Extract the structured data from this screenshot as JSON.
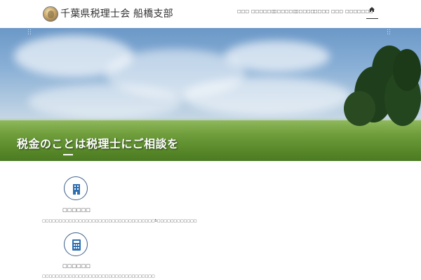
{
  "header": {
    "site_title": "千葉県税理士会 船橋支部",
    "nav": [
      {
        "label": "□□□"
      },
      {
        "label": "□□□□□□"
      },
      {
        "label": "□□□□□□"
      },
      {
        "label": "□□□□□"
      },
      {
        "label": "□□□□"
      },
      {
        "label": "□□□"
      },
      {
        "label": "□□□□□□□"
      }
    ],
    "home_icon": "home-icon"
  },
  "hero": {
    "tagline": "税金のことは税理士にご相談を"
  },
  "features": [
    {
      "icon": "building-icon",
      "title": "□□□□□□",
      "desc": "□□□□□□□□□□□□□□□□□□□□□□□□□□□□□□□□□□5□□□□□□□□□□□□"
    },
    {
      "icon": "calculator-icon",
      "title": "□□□□□□",
      "desc": "□□□□□□□□□□□□□□□□□□□□□□□□□□□□□□□□□□"
    }
  ],
  "colors": {
    "icon_blue": "#2f6fb0",
    "icon_border": "#3c5f8a"
  }
}
